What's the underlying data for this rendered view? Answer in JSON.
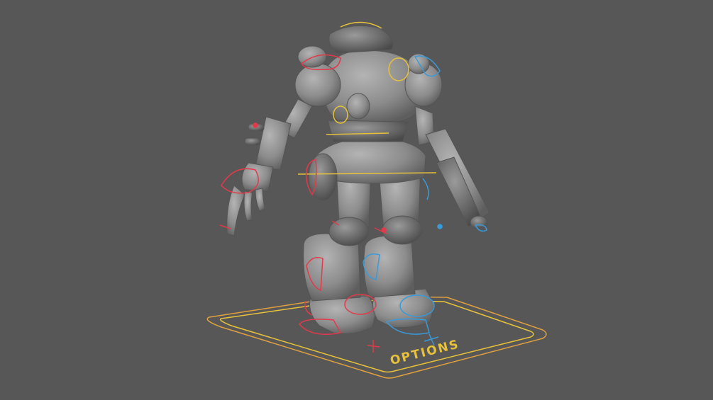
{
  "viewport": {
    "background": "#575757",
    "model": "robot-mech-rigged",
    "shading": "#8f8f8f"
  },
  "rig": {
    "options_label": "OPTIONS",
    "colors": {
      "center": "#e8c23a",
      "ground_outer": "#e0a040",
      "left": "#e23a4a",
      "right": "#3a9ad9"
    }
  }
}
